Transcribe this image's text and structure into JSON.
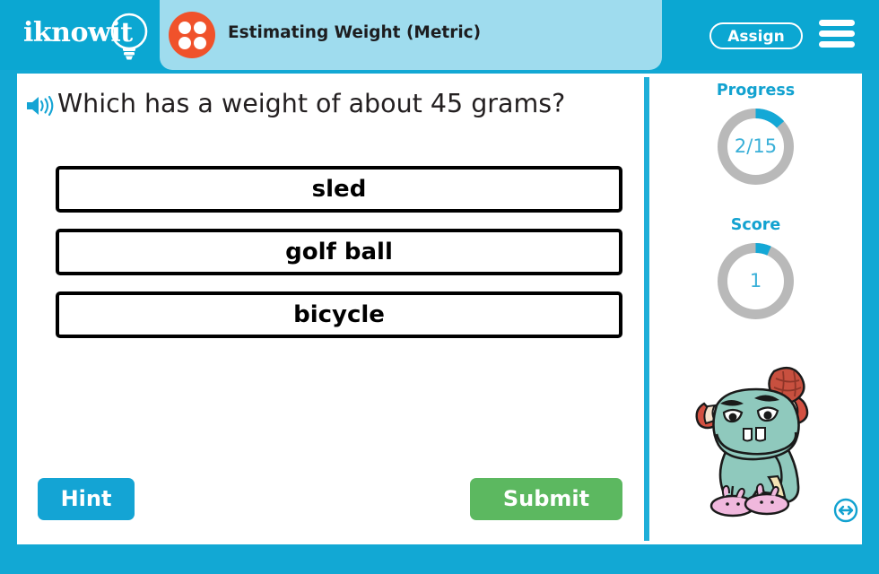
{
  "header": {
    "logo_text": "iknowit",
    "logo_icon": "lightbulb-icon",
    "lesson_icon": "four-dots-circle-icon",
    "title": "Estimating Weight (Metric)",
    "assign_label": "Assign",
    "menu_icon": "hamburger-menu-icon",
    "background_color": "#0ba7d2",
    "title_pill_color": "#9fdcee",
    "lesson_icon_color": "#f0522b"
  },
  "question": {
    "speaker_icon": "speaker-audio-icon",
    "text": "Which has a weight of about 45 grams?"
  },
  "answers": [
    {
      "label": "sled"
    },
    {
      "label": "golf ball"
    },
    {
      "label": "bicycle"
    }
  ],
  "actions": {
    "hint_label": "Hint",
    "hint_color": "#14a4d4",
    "submit_label": "Submit",
    "submit_color": "#5cb860"
  },
  "sidebar": {
    "progress": {
      "title": "Progress",
      "value_text": "2/15",
      "current": 2,
      "total": 15,
      "fraction": 0.1333,
      "arc_color": "#14a8d6",
      "track_color": "#b9b9b9"
    },
    "score": {
      "title": "Score",
      "value_text": "1",
      "current": 1,
      "fraction": 0.0667,
      "arc_color": "#14a8d6",
      "track_color": "#b9b9b9"
    },
    "mascot": {
      "name": "monster-mascot",
      "body_color": "#8fc9bd",
      "hat_color": "#d35041",
      "slipper_color": "#f0b8dd"
    },
    "resize_icon": "resize-horizontal-icon"
  }
}
